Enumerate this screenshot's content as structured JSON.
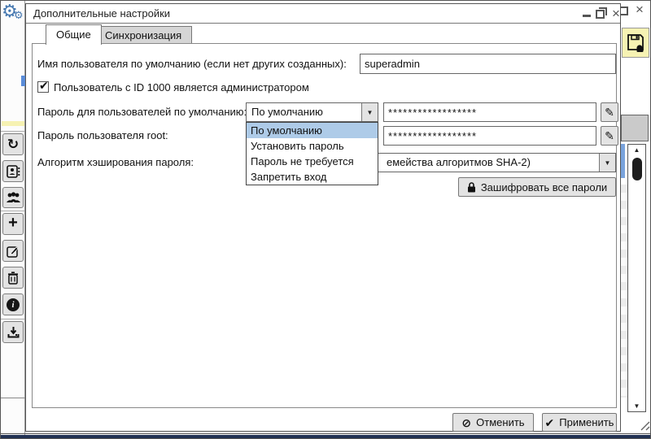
{
  "dialog": {
    "title": "Дополнительные настройки",
    "tabs": [
      {
        "label": "Общие"
      },
      {
        "label": "Синхронизация"
      }
    ],
    "form": {
      "username_label": "Имя пользователя по умолчанию (если нет других созданных):",
      "username_value": "superadmin",
      "admin_checkbox_label": "Пользователь с ID 1000 является администратором",
      "default_password_label": "Пароль для пользователей по умолчанию:",
      "default_password_mode": "По умолчанию",
      "default_password_value": "******************",
      "root_password_label": "Пароль пользователя root:",
      "root_password_value": "******************",
      "hash_label": "Алгоритм хэширования пароля:",
      "hash_value_visible": "емейства алгоритмов SHA-2)",
      "encrypt_all_label": "Зашифровать все пароли"
    },
    "password_mode_options": [
      "По умолчанию",
      "Установить пароль",
      "Пароль не требуется",
      "Запретить вход"
    ],
    "footer": {
      "cancel_label": "Отменить",
      "apply_label": "Применить"
    }
  },
  "icons": {
    "gear": "⚙",
    "warning": "⚠",
    "refresh": "↻",
    "plus": "+",
    "pencil": "✎",
    "cancel": "⊘",
    "check": "✔",
    "arrow_down": "▼",
    "arrow_up": "▲",
    "close": "×",
    "info": "i"
  },
  "colors": {
    "selection_blue": "#aecbe8",
    "accent_blue": "#4678b0",
    "warning_yellow": "#f6f2b3",
    "dark_bar": "#203052"
  }
}
